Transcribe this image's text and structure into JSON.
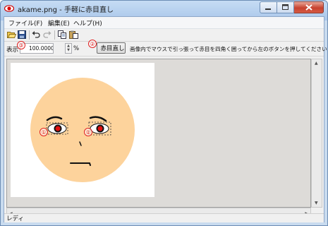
{
  "window": {
    "title": "akame.png - 手軽に赤目直し"
  },
  "menu": {
    "items": [
      "ファイル(F)",
      "編集(E)",
      "ヘルプ(H)"
    ]
  },
  "toolbar": {
    "icons": [
      "open-folder-icon",
      "save-icon",
      "undo-icon",
      "redo-icon",
      "copy-icon",
      "paste-icon"
    ]
  },
  "options": {
    "zoom_label": "表示",
    "zoom_value": "100.00000",
    "percent": "%",
    "fix_button": "赤目直し",
    "instruction": "画像内でマウスで引っ張って赤目を四角く囲ってから左のボタンを押してください。"
  },
  "annotations": {
    "marker_1": "①",
    "marker_2": "②",
    "marker_3": "③"
  },
  "status": {
    "text": "レディ"
  },
  "colors": {
    "face": "#fdd39c",
    "red_eye": "#e01010",
    "annotation": "#e02020"
  }
}
